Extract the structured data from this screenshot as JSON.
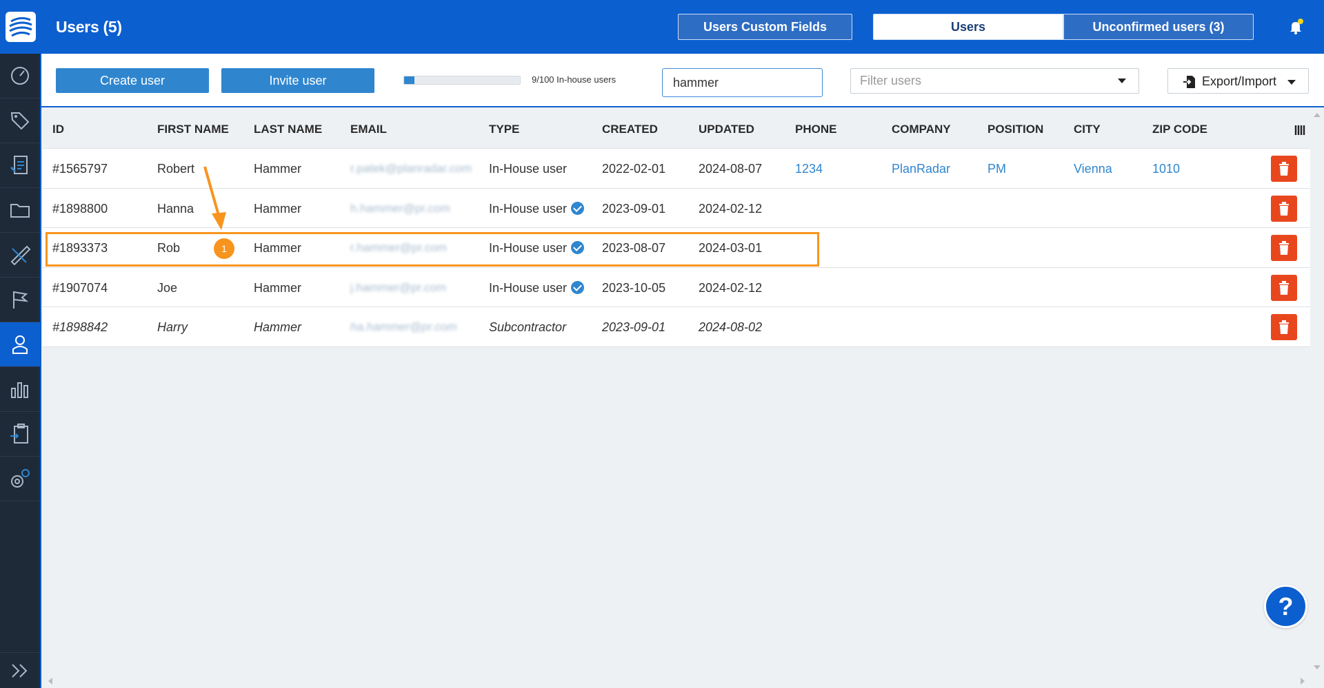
{
  "header": {
    "title": "Users (5)",
    "custom_fields_label": "Users Custom Fields",
    "users_tab_label": "Users",
    "unconfirmed_tab_label": "Unconfirmed users (3)",
    "notification_dot_color": "#f5d614"
  },
  "toolbar": {
    "create_label": "Create user",
    "invite_label": "Invite user",
    "usage_label": "9/100 In-house users",
    "usage_progress": 0.09,
    "search_value": "hammer",
    "filter_placeholder": "Filter users",
    "export_label": "Export/Import"
  },
  "table": {
    "columns": [
      "ID",
      "FIRST NAME",
      "LAST NAME",
      "EMAIL",
      "TYPE",
      "CREATED",
      "UPDATED",
      "PHONE",
      "COMPANY",
      "POSITION",
      "CITY",
      "ZIP CODE"
    ],
    "rows": [
      {
        "id": "#1565797",
        "first": "Robert",
        "last": "Hammer",
        "email": "r.patek@planradar.com",
        "type": "In-House user",
        "verified": false,
        "created": "2022-02-01",
        "updated": "2024-08-07",
        "phone": "1234",
        "company": "PlanRadar",
        "position": "PM",
        "city": "Vienna",
        "zip": "1010"
      },
      {
        "id": "#1898800",
        "first": "Hanna",
        "last": "Hammer",
        "email": "h.hammer@pr.com",
        "type": "In-House user",
        "verified": true,
        "created": "2023-09-01",
        "updated": "2024-02-12",
        "phone": "",
        "company": "",
        "position": "",
        "city": "",
        "zip": ""
      },
      {
        "id": "#1893373",
        "first": "Rob",
        "last": "Hammer",
        "email": "r.hammer@pr.com",
        "type": "In-House user",
        "verified": true,
        "created": "2023-08-07",
        "updated": "2024-03-01",
        "phone": "",
        "company": "",
        "position": "",
        "city": "",
        "zip": ""
      },
      {
        "id": "#1907074",
        "first": "Joe",
        "last": "Hammer",
        "email": "j.hammer@pr.com",
        "type": "In-House user",
        "verified": true,
        "created": "2023-10-05",
        "updated": "2024-02-12",
        "phone": "",
        "company": "",
        "position": "",
        "city": "",
        "zip": ""
      },
      {
        "id": "#1898842",
        "first": "Harry",
        "last": "Hammer",
        "email": "ha.hammer@pr.com",
        "type": "Subcontractor",
        "verified": false,
        "created": "2023-09-01",
        "updated": "2024-08-02",
        "phone": "",
        "company": "",
        "position": "",
        "city": "",
        "zip": ""
      }
    ]
  },
  "annotation": {
    "badge_number": "1",
    "color": "#f7941d"
  },
  "help_label": "?",
  "sidebar": {
    "items": [
      "dashboard-icon",
      "tags-icon",
      "reports-icon",
      "folder-icon",
      "ruler-icon",
      "flag-icon",
      "user-icon",
      "stats-icon",
      "clipboard-icon",
      "settings-icon"
    ],
    "active_index": 6
  },
  "colors": {
    "brand": "#0c5fcf",
    "primary_button": "#2f86cf",
    "delete": "#e8471e",
    "sidebar": "#1e2a38"
  }
}
